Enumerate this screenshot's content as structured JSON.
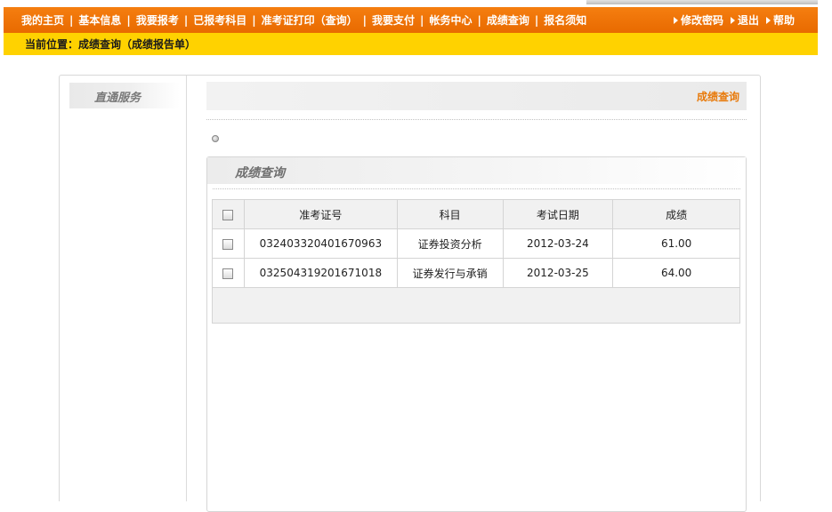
{
  "nav": {
    "items": [
      "我的主页",
      "基本信息",
      "我要报考",
      "已报考科目",
      "准考证打印（查询）",
      "我要支付",
      "帐务中心",
      "成绩查询",
      "报名须知"
    ],
    "right": [
      "修改密码",
      "退出",
      "帮助"
    ]
  },
  "breadcrumb": {
    "prefix": "当前位置：",
    "text": "成绩查询（成绩报告单）"
  },
  "sidebar": {
    "title": "直通服务"
  },
  "header": {
    "title": "成绩查询"
  },
  "panel": {
    "title": "成绩查询"
  },
  "table": {
    "headers": [
      "准考证号",
      "科目",
      "考试日期",
      "成绩"
    ],
    "rows": [
      [
        "032403320401670963",
        "证券投资分析",
        "2012-03-24",
        "61.00"
      ],
      [
        "032504319201671018",
        "证券发行与承销",
        "2012-03-25",
        "64.00"
      ]
    ]
  },
  "colors": {
    "nav_bg": "#f07800",
    "crumb_bg": "#ffd200",
    "accent": "#e87a0b"
  }
}
